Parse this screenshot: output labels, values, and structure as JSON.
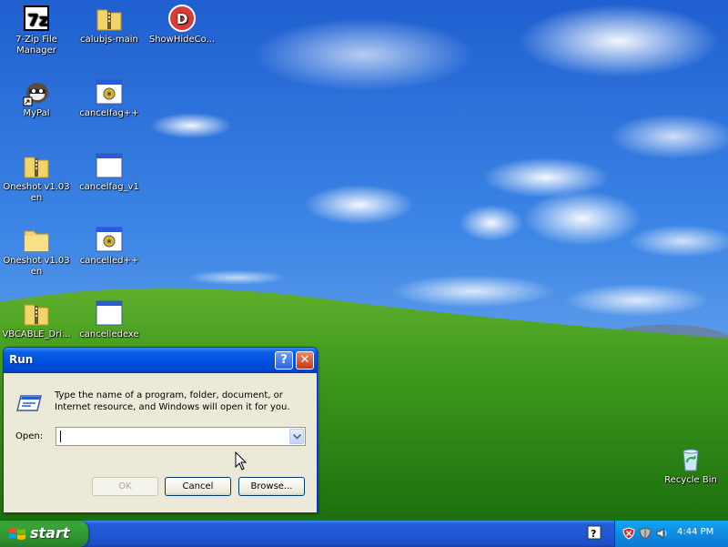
{
  "desktop": {
    "icons": [
      {
        "label": "7-Zip File Manager",
        "icon": "7zip-icon"
      },
      {
        "label": "calubjs-main",
        "icon": "zip-folder-icon"
      },
      {
        "label": "ShowHideCo...",
        "icon": "showhide-app-icon"
      },
      {
        "label": "MyPal",
        "icon": "mypal-browser-icon"
      },
      {
        "label": "cancelfag++",
        "icon": "exe-gear-icon"
      },
      {
        "label": "Oneshot v1.03 en",
        "icon": "zip-folder-icon"
      },
      {
        "label": "cancelfag_v1",
        "icon": "window-exe-icon"
      },
      {
        "label": "Oneshot v1.03 en",
        "icon": "folder-icon"
      },
      {
        "label": "cancelled++",
        "icon": "exe-gear-icon"
      },
      {
        "label": "VBCABLE_Dri...",
        "icon": "zip-folder-icon"
      },
      {
        "label": "cancelledexe",
        "icon": "window-exe-icon"
      },
      {
        "label": "Recycle Bin",
        "icon": "recycle-bin-icon"
      }
    ]
  },
  "run_dialog": {
    "title": "Run",
    "help_label": "?",
    "close_label": "✕",
    "description": "Type the name of a program, folder, document, or Internet resource, and Windows will open it for you.",
    "open_label": "Open:",
    "open_value": "",
    "ok_label": "OK",
    "cancel_label": "Cancel",
    "browse_label": "Browse..."
  },
  "taskbar": {
    "start_label": "start",
    "clock": "4:44 PM"
  },
  "colors": {
    "title_bar": "#0050de",
    "start_green": "#37a537",
    "taskbar_blue": "#245edb",
    "dialog_face": "#ece9d8"
  }
}
